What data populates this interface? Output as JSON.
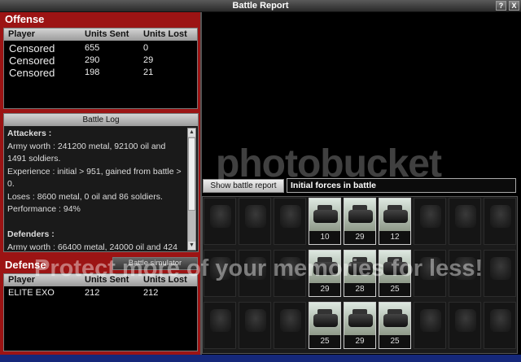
{
  "window": {
    "title": "Battle Report",
    "help_label": "?",
    "close_label": "X"
  },
  "offense": {
    "title": "Offense",
    "columns": [
      "Player",
      "Units Sent",
      "Units Lost"
    ],
    "rows": [
      {
        "player": "Censored",
        "sent": "655",
        "lost": "0"
      },
      {
        "player": "Censored",
        "sent": "290",
        "lost": "29"
      },
      {
        "player": "Censored",
        "sent": "198",
        "lost": "21"
      }
    ]
  },
  "battle_log": {
    "title": "Battle Log",
    "lines": [
      "Attackers :",
      "Army worth : 241200 metal, 92100 oil and",
      "1491 soldiers.",
      "Experience : initial > 951, gained from battle >",
      "0.",
      "Loses : 8600 metal, 0 oil and 86 soldiers.",
      "Performance : 94%",
      "",
      "Defenders :",
      "Army worth : 66400 metal, 24000 oil and 424"
    ]
  },
  "battle_simulator_label": "Battle simulator",
  "defense": {
    "title": "Defense",
    "columns": [
      "Player",
      "Units Sent",
      "Units Lost"
    ],
    "rows": [
      {
        "player": "ELITE EXO",
        "sent": "212",
        "lost": "212"
      }
    ]
  },
  "show_battle_report_label": "Show battle report",
  "forces_caption": "Initial forces in battle",
  "unit_grid": {
    "counts": [
      [
        "",
        "",
        "",
        "10",
        "29",
        "12",
        "",
        "",
        ""
      ],
      [
        "",
        "",
        "",
        "29",
        "28",
        "25",
        "",
        "",
        ""
      ],
      [
        "",
        "",
        "",
        "25",
        "29",
        "25",
        "",
        "",
        ""
      ]
    ]
  },
  "watermark": {
    "line1": "photobucket",
    "line2": "Protect more of your memories for less!"
  },
  "colors": {
    "left_panel": "#9c1414",
    "bottom_strip": "#15287a"
  }
}
